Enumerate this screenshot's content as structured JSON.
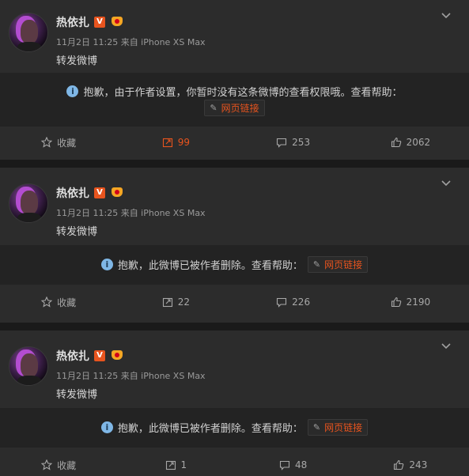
{
  "posts": [
    {
      "author": "热依扎",
      "meta": "11月2日 11:25 来自 iPhone XS Max",
      "text": "转发微博",
      "notice": "抱歉，由于作者设置，你暂时没有这条微博的查看权限哦。查看帮助：",
      "link_label": "网页链接",
      "actions": {
        "favorite": "收藏",
        "repost": "99",
        "comment": "253",
        "like": "2062"
      },
      "repost_highlight": true
    },
    {
      "author": "热依扎",
      "meta": "11月2日 11:25 来自 iPhone XS Max",
      "text": "转发微博",
      "notice": "抱歉，此微博已被作者删除。查看帮助：",
      "link_label": "网页链接",
      "actions": {
        "favorite": "收藏",
        "repost": "22",
        "comment": "226",
        "like": "2190"
      },
      "repost_highlight": false
    },
    {
      "author": "热依扎",
      "meta": "11月2日 11:25 来自 iPhone XS Max",
      "text": "转发微博",
      "notice": "抱歉，此微博已被作者删除。查看帮助：",
      "link_label": "网页链接",
      "actions": {
        "favorite": "收藏",
        "repost": "1",
        "comment": "48",
        "like": "243"
      },
      "repost_highlight": false
    }
  ],
  "badges": {
    "verified": "V"
  },
  "icons": {
    "menu": "chevron-down-icon",
    "info": "info-icon",
    "link": "pencil-icon",
    "favorite": "star-icon",
    "repost": "repost-icon",
    "comment": "comment-icon",
    "like": "thumbs-up-icon"
  },
  "colors": {
    "accent": "#e8541e",
    "card": "#2c2c2c",
    "notice_bg": "#232323",
    "info": "#7fb7e6"
  }
}
